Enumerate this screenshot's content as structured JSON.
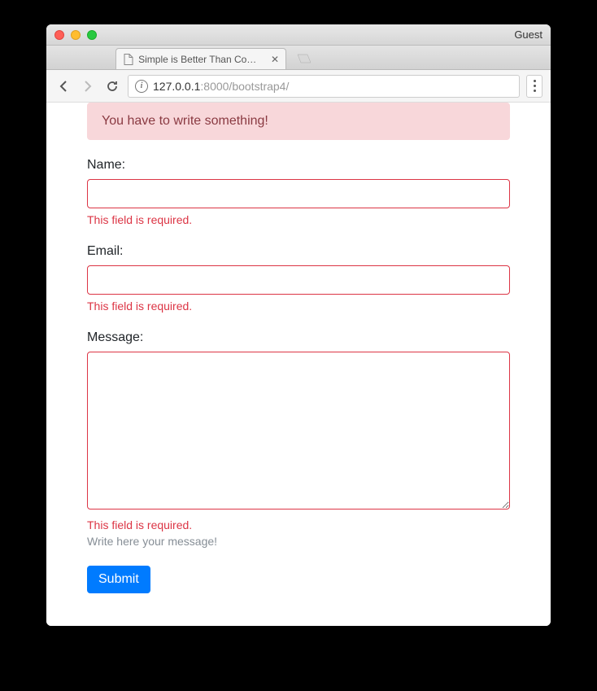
{
  "window": {
    "guest_label": "Guest"
  },
  "tab": {
    "title": "Simple is Better Than Complex"
  },
  "url": {
    "host": "127.0.0.1",
    "port_path": ":8000/bootstrap4/"
  },
  "alert": {
    "message": "You have to write something!"
  },
  "form": {
    "name": {
      "label": "Name:",
      "value": "",
      "error": "This field is required."
    },
    "email": {
      "label": "Email:",
      "value": "",
      "error": "This field is required."
    },
    "message": {
      "label": "Message:",
      "value": "",
      "error": "This field is required.",
      "help": "Write here your message!"
    },
    "submit_label": "Submit"
  }
}
